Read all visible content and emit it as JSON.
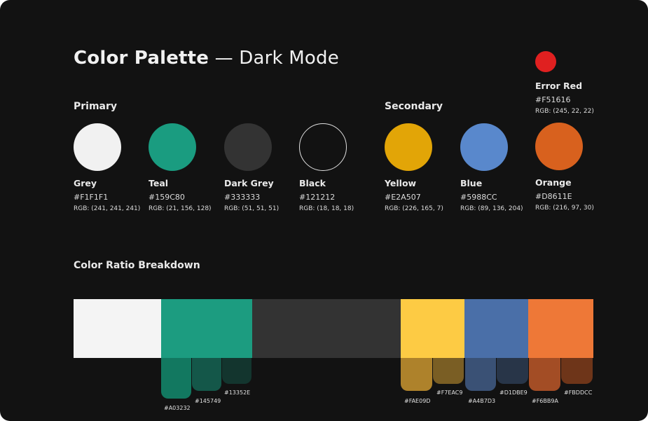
{
  "title": {
    "bold": "Color Palette",
    "separator": "—",
    "subtitle": "Dark Mode"
  },
  "sections": {
    "primary": "Primary",
    "secondary": "Secondary",
    "ratio": "Color Ratio Breakdown"
  },
  "primary": [
    {
      "name": "Grey",
      "hex": "#F1F1F1",
      "rgb": "RGB: (241, 241, 241)",
      "color": "#F1F1F1"
    },
    {
      "name": "Teal",
      "hex": "#159C80",
      "rgb": "RGB: (21, 156, 128)",
      "color": "#1A9C80"
    },
    {
      "name": "Dark Grey",
      "hex": "#333333",
      "rgb": "RGB: (51, 51, 51)",
      "color": "#333333"
    },
    {
      "name": "Black",
      "hex": "#121212",
      "rgb": "RGB: (18, 18, 18)",
      "color": "#121212",
      "outline": "#e0e0e0"
    }
  ],
  "secondary": [
    {
      "name": "Yellow",
      "hex": "#E2A507",
      "rgb": "RGB: (226, 165, 7)",
      "color": "#E2A507"
    },
    {
      "name": "Blue",
      "hex": "#5988CC",
      "rgb": "RGB: (89, 136, 204)",
      "color": "#5988CC"
    },
    {
      "name": "Orange",
      "hex": "#D8611E",
      "rgb": "RGB: (216, 97, 30)",
      "color": "#D8611E"
    }
  ],
  "error": {
    "name": "Error Red",
    "hex": "#F51616",
    "rgb": "RGB: (245, 22, 22)",
    "color": "#E02020"
  },
  "ratio_bar": {
    "segments": [
      {
        "color": "#F4F4F4",
        "share": 0.168
      },
      {
        "color": "#1C9C80",
        "share": 0.176
      },
      {
        "color": "#333333",
        "share": 0.285
      },
      {
        "color": "#FDCB44",
        "share": 0.123
      },
      {
        "color": "#4A6FA8",
        "share": 0.123
      },
      {
        "color": "#EE7837",
        "share": 0.125
      }
    ],
    "shades": [
      {
        "label": "#A03232",
        "color": "#127860"
      },
      {
        "label": "#145749",
        "color": "#145749"
      },
      {
        "label": "#13352E",
        "color": "#13352E"
      },
      {
        "label": "#FAE09D",
        "color": "#AE822B"
      },
      {
        "label": "#F7EAC9",
        "color": "#7A5E24"
      },
      {
        "label": "#A4B7D3",
        "color": "#3A5175"
      },
      {
        "label": "#D1DBE9",
        "color": "#283548"
      },
      {
        "label": "#F6BB9A",
        "color": "#A34D25"
      },
      {
        "label": "#FBDDCC",
        "color": "#6E3519"
      }
    ]
  }
}
